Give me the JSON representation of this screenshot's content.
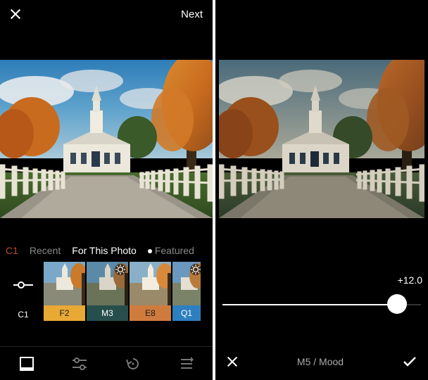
{
  "left": {
    "next_label": "Next",
    "tabs": {
      "active": "C1",
      "recent": "Recent",
      "for_this": "For This Photo",
      "featured": "Featured"
    },
    "filters": {
      "c1": "C1",
      "f2": {
        "label": "F2",
        "color": "#e8a935"
      },
      "m3": {
        "label": "M3",
        "color": "#264e4c"
      },
      "e8": {
        "label": "E8",
        "color": "#d07b3e"
      },
      "q1": {
        "label": "Q1",
        "color": "#2d7fbf"
      }
    }
  },
  "right": {
    "value": "+12.0",
    "filter_name": "M5 / Mood",
    "slider_position": 0.88
  }
}
